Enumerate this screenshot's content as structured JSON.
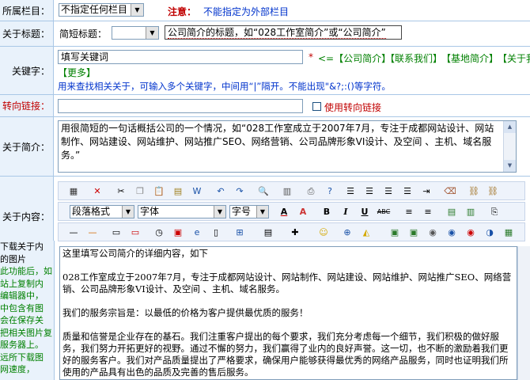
{
  "column_row": {
    "label": "所属栏目：",
    "select_value": "不指定任何栏目",
    "note_label": "注意：",
    "note_text": "不能指定为外部栏目"
  },
  "title_row": {
    "label": "关于标题：",
    "short_label": "简短标题：",
    "short_select_value": "",
    "title_value": "公司简介的标题，如“028工作室简介”或“公司简介”"
  },
  "keyword_row": {
    "label": "关键字：",
    "input_value": "填写关键词",
    "star": "*",
    "arrow_link": "<=【公司简介】",
    "links": [
      "【联系我们】",
      "【基地简介】",
      "【关于我们】",
      "【更多】"
    ],
    "hint": "用来查找相关关于，可输入多个关键字，中间用“|”隔开。不能出现\"&?;:()等字符。"
  },
  "redirect_row": {
    "label": "转向链接：",
    "input_value": "",
    "checkbox_label": "使用转向链接"
  },
  "intro_row": {
    "label": "关于简介：",
    "text": "用很简短的一句话概括公司的一个情况，如“028工作室成立于2007年7月，专注于成都网站设计、网站制作、网站建设、网站维护、网站推广SEO、网络营销、公司品牌形象VI设计、及空间 、主机、域名服务。”"
  },
  "content_row": {
    "label": "关于内容：",
    "toolbar": {
      "paragraph_select": "段落格式",
      "font_select": "字体",
      "size_select": "字号"
    },
    "editor_paragraphs": [
      "这里填写公司简介的详细内容，如下",
      "028工作室成立于2007年7月，专注于成都网站设计、网站制作、网站建设、网站维护、网站推广SEO、网络营销、公司品牌形象VI设计、及空间 、主机、域名服务。",
      "我们的服务宗旨是：以最低的价格为客户提供最优质的服务！",
      "质量和信誉是企业存在的基石。我们注重客户提出的每个要求，我们充分考虑每一个细节，我们积极的做好服务，我们努力开拓更好的视野。通过不懈的努力，我们赢得了业内的良好声誉。这一切，也不断的激励着我们更好的服务客户。我们对产品质量提出了严格要求，确保用户能够获得最优秀的网络产品服务，同时也证明我们所使用的产品具有出色的品质及完善的售后服务。"
    ],
    "left_note": [
      "下载关于内",
      "的图片",
      "此功能后，如",
      "站上复制内",
      "编辑器中，",
      "中包含有图",
      "会在保存关",
      "把相关图片复",
      "服务器上。",
      "远所下载图",
      "网速度，"
    ]
  },
  "colors": {
    "label_bg": "#e9f2fb",
    "border": "#a9c7e6",
    "note_red": "#c00000",
    "link_green": "#008000",
    "hint_blue": "#0033cc"
  }
}
